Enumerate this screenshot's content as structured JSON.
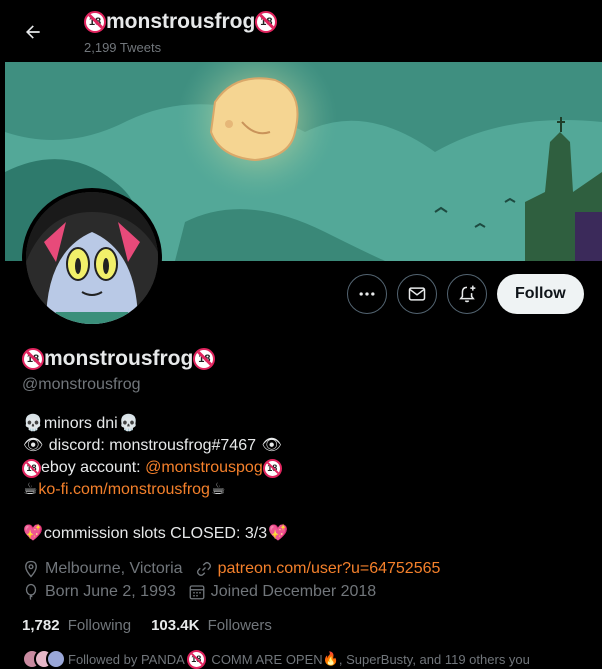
{
  "topbar": {
    "name": "monstrousfrog",
    "tweet_count": "2,199 Tweets"
  },
  "profile": {
    "name": "monstrousfrog",
    "handle": "@monstrousfrog"
  },
  "bio": {
    "line1_text": "minors dni",
    "line2_text": " discord: monstrousfrog#7467 ",
    "line3_prefix": "eboy account: ",
    "line3_link": "@monstrouspog",
    "line4_link": "ko-fi.com/monstrousfrog",
    "line5_text": "commission slots CLOSED: 3/3"
  },
  "meta": {
    "location": "Melbourne, Victoria",
    "website": "patreon.com/user?u=64752565",
    "born": "Born June 2, 1993",
    "joined": "Joined December 2018"
  },
  "stats": {
    "following_count": "1,782",
    "following_label": "Following",
    "followers_count": "103.4K",
    "followers_label": "Followers"
  },
  "followed_by": {
    "prefix": "Followed by PANDA",
    "middle": " COMM ARE OPEN",
    "suffix": ", SuperBusty, and 119 others you"
  },
  "buttons": {
    "follow_label": "Follow"
  },
  "icons": {
    "back": "arrow-left-icon",
    "more": "more-dots-icon",
    "message": "envelope-icon",
    "notify": "bell-plus-icon",
    "location": "location-pin-icon",
    "link": "link-icon",
    "birthday": "balloon-icon",
    "calendar": "calendar-icon"
  },
  "colors": {
    "background": "#000000",
    "text": "#e7e9ea",
    "muted": "#71767b",
    "link": "#f4802b",
    "banner": "#4fa494"
  }
}
